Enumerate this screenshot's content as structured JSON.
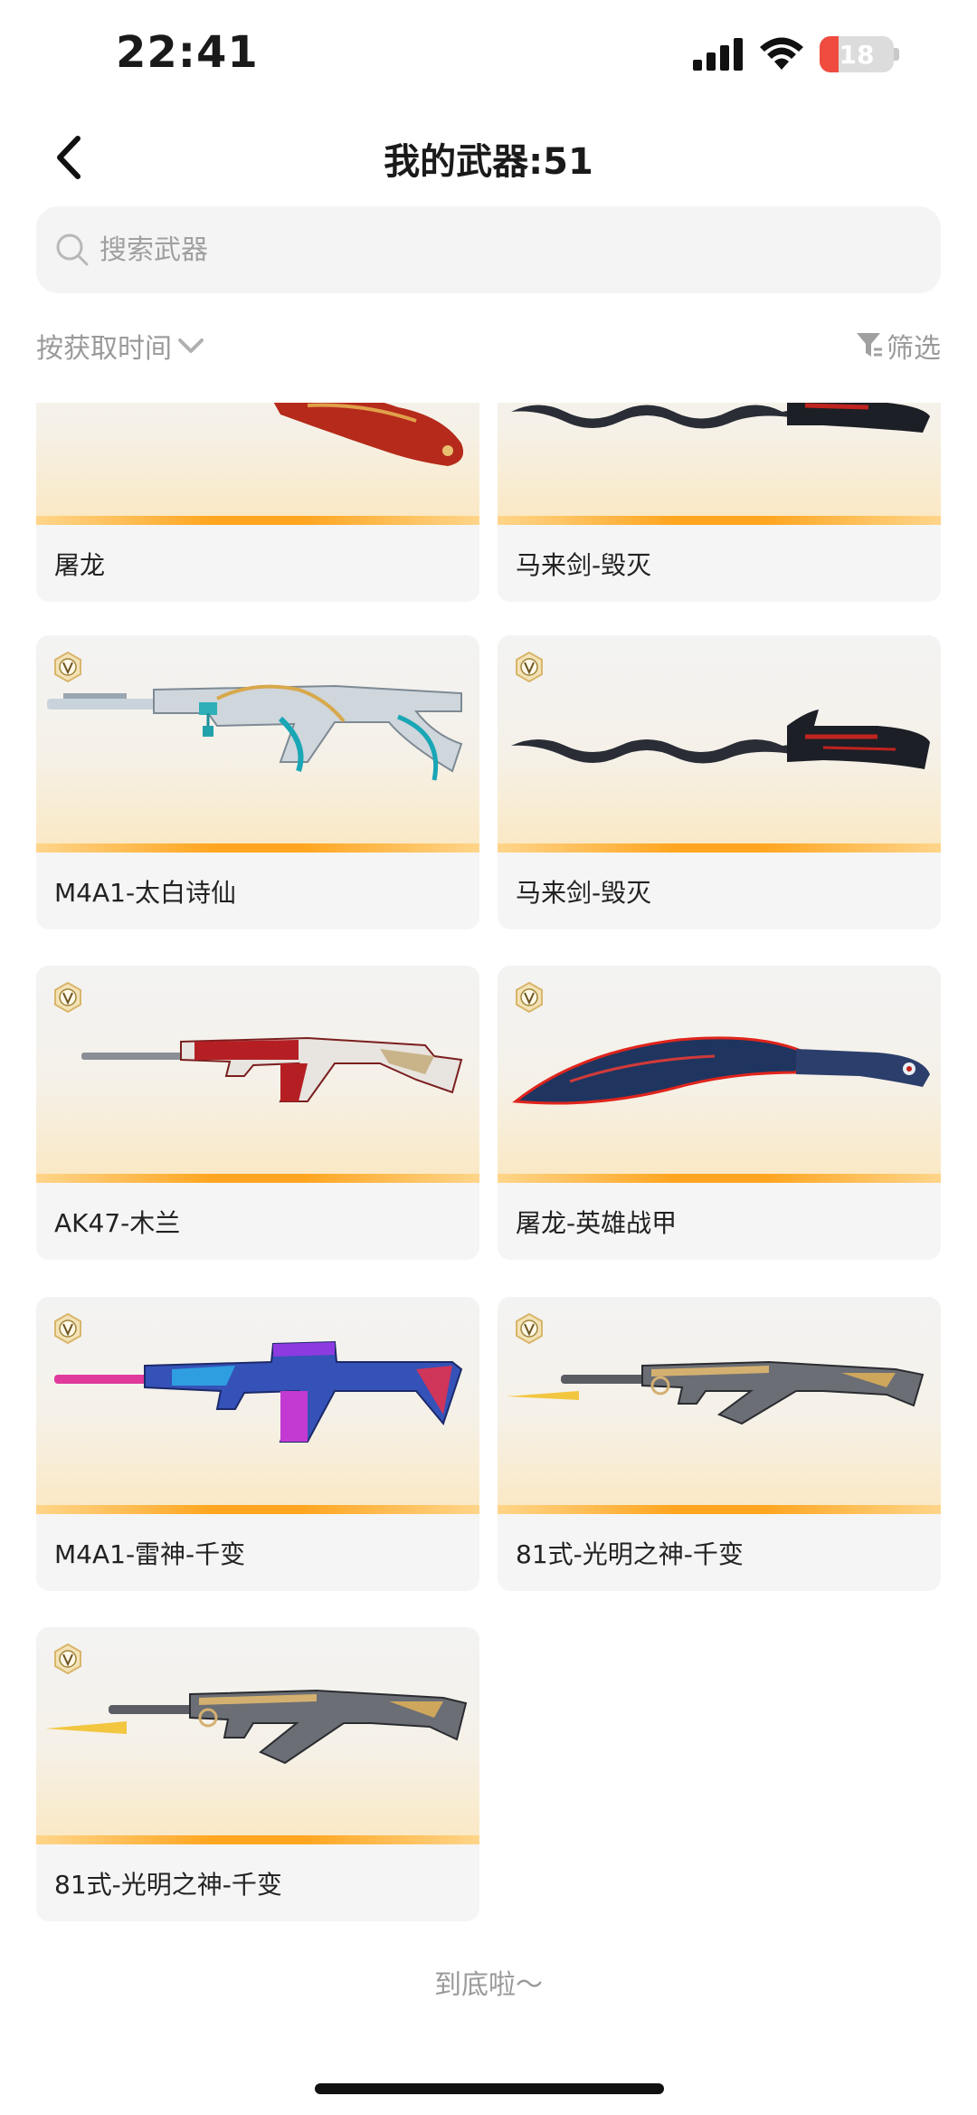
{
  "status_bar": {
    "time": "22:41",
    "battery": "18"
  },
  "header": {
    "title": "我的武器:51"
  },
  "search": {
    "placeholder": "搜索武器"
  },
  "sort": {
    "label": "按获取时间"
  },
  "filter": {
    "label": "筛选"
  },
  "weapons": [
    {
      "name": "屠龙",
      "badge": false
    },
    {
      "name": "马来剑-毁灭",
      "badge": false
    },
    {
      "name": "M4A1-太白诗仙",
      "badge": true
    },
    {
      "name": "马来剑-毁灭",
      "badge": true
    },
    {
      "name": "AK47-木兰",
      "badge": true
    },
    {
      "name": "屠龙-英雄战甲",
      "badge": true
    },
    {
      "name": "M4A1-雷神-千变",
      "badge": true
    },
    {
      "name": "81式-光明之神-千变",
      "badge": true
    },
    {
      "name": "81式-光明之神-千变",
      "badge": true
    }
  ],
  "footer": {
    "text": "到底啦～"
  }
}
